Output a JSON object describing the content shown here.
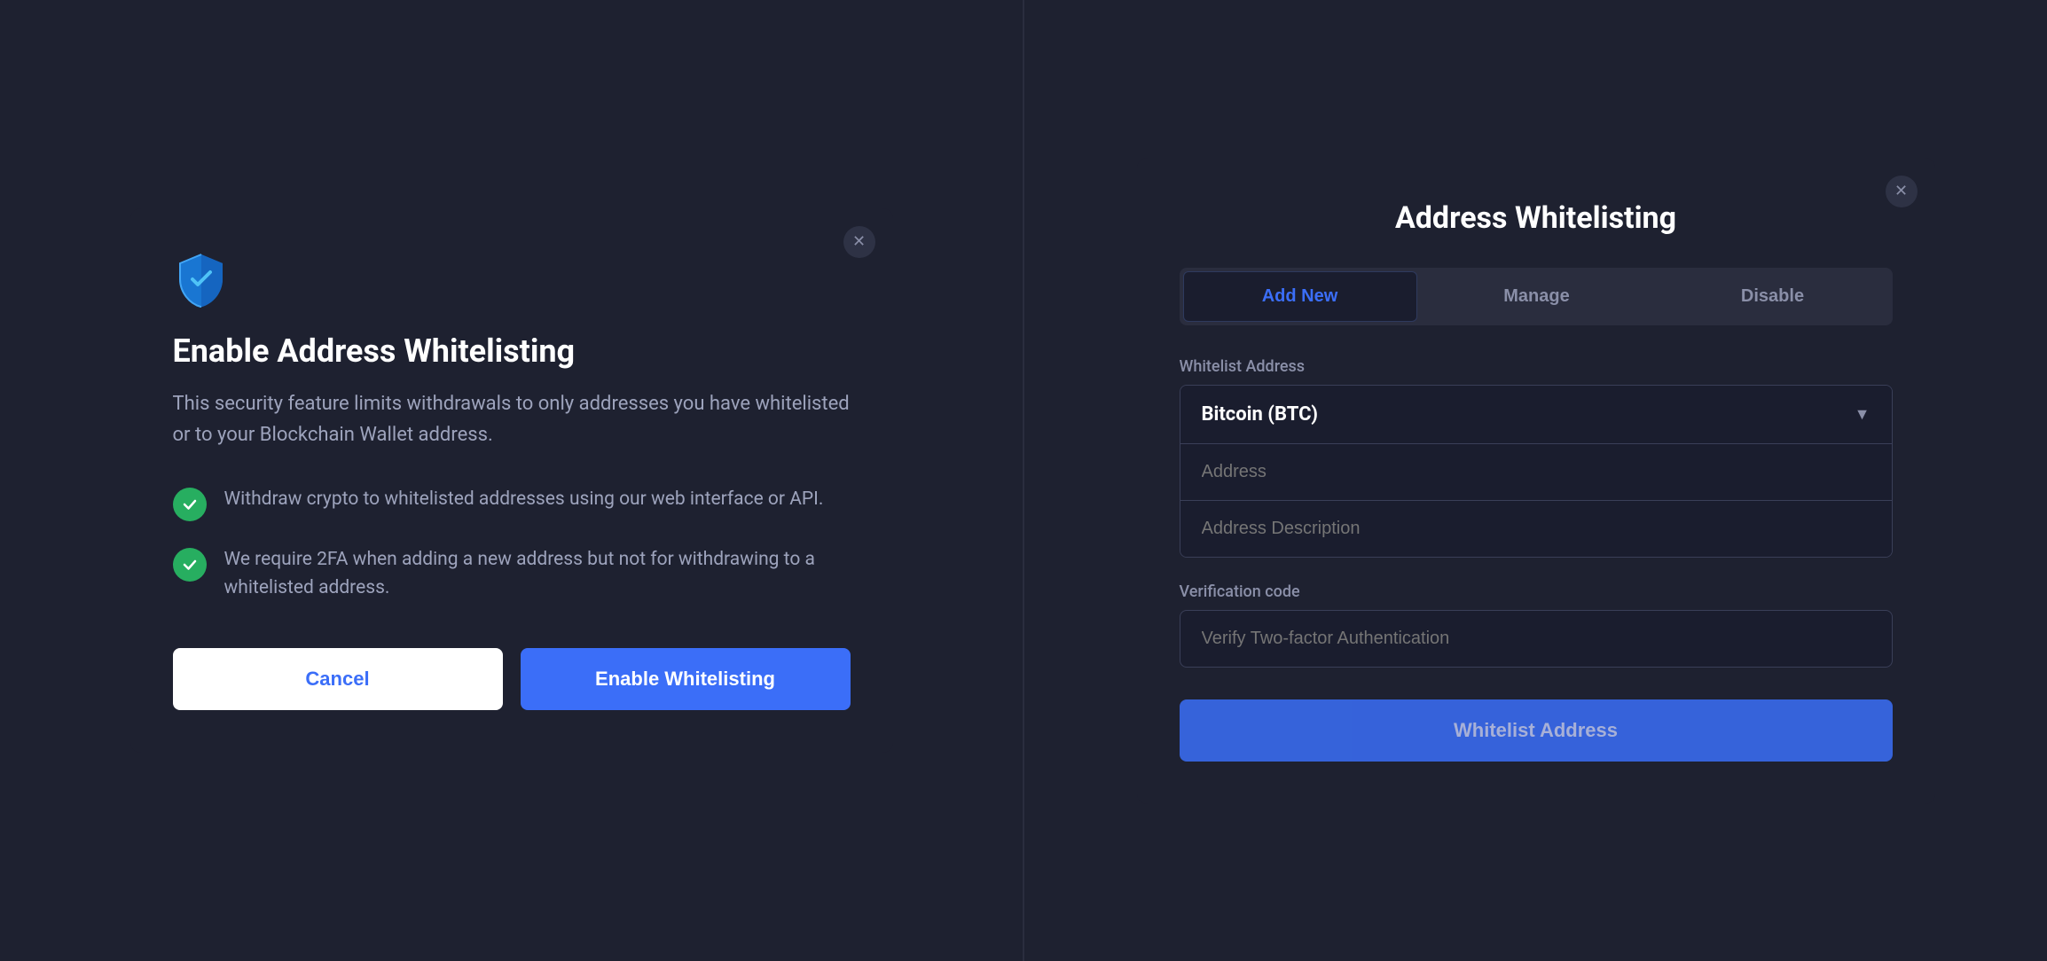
{
  "left_modal": {
    "title": "Enable Address Whitelisting",
    "description": "This security feature limits withdrawals to only addresses you have whitelisted or to your Blockchain Wallet address.",
    "features": [
      {
        "text": "Withdraw crypto to whitelisted addresses using our web interface or API."
      },
      {
        "text": "We require 2FA when adding a new address but not for withdrawing to a whitelisted address."
      }
    ],
    "cancel_label": "Cancel",
    "enable_label": "Enable Whitelisting",
    "close_label": "✕"
  },
  "right_modal": {
    "title": "Address Whitelisting",
    "close_label": "✕",
    "tabs": [
      {
        "id": "add-new",
        "label": "Add New",
        "active": true
      },
      {
        "id": "manage",
        "label": "Manage",
        "active": false
      },
      {
        "id": "disable",
        "label": "Disable",
        "active": false
      }
    ],
    "whitelist_address_label": "Whitelist Address",
    "select_value": "Bitcoin (BTC)",
    "address_placeholder": "Address",
    "address_description_placeholder": "Address Description",
    "verification_code_label": "Verification code",
    "verify_placeholder": "Verify Two-factor Authentication",
    "submit_label": "Whitelist Address"
  }
}
